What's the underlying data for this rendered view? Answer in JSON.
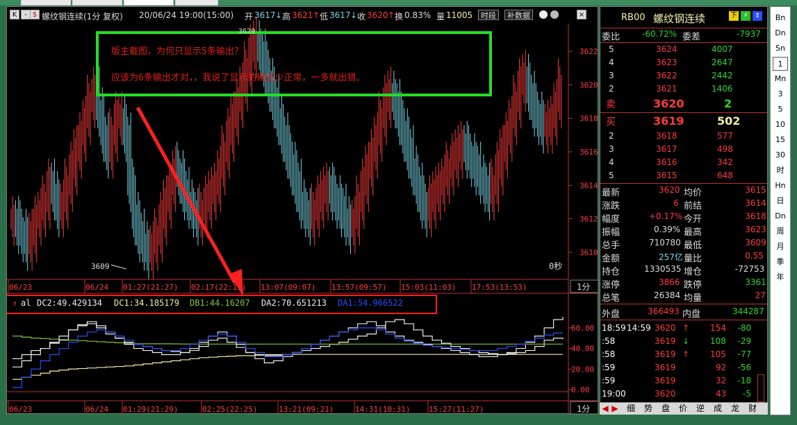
{
  "toolbar": {
    "k_btn": "K",
    "symbol": "螺纹钢连续(1分 复权)",
    "datetime": "20/06/24 19:00(15:00)",
    "open_label": "开",
    "open_value": "3617",
    "high_label": "高",
    "high_value": "3621",
    "low_label": "低",
    "low_value": "3617",
    "close_label": "收",
    "close_value": "3620",
    "turnover_label": "换",
    "turnover_value": "0.83%",
    "volume_label": "量",
    "volume_value": "11005",
    "btn_period": "时段",
    "btn_supplement": "补数据"
  },
  "annotation": {
    "line1": "版主截图，为何只显示5条输出？",
    "line2": "应该为6条输出才对，，我说了显示的输出少正常，一多就出错。",
    "peak_label": "3620"
  },
  "main_panel": {
    "low_marker": "3609",
    "countdown": "0秒",
    "period": "1分",
    "y_ticks": [
      "3622",
      "3620",
      "3618",
      "3616",
      "3614",
      "3612",
      "3610"
    ],
    "x_ticks": [
      "06/23",
      "06/24",
      "01:27(21:27)",
      "02:17(22:17)",
      "13:07(09:07)",
      "13:57(09:57)",
      "15:03(11:03)",
      "17:53(13:53)"
    ]
  },
  "indicator": {
    "name": "al",
    "dc2": "DC2:49.429134",
    "dc1": "DC1:34.185179",
    "db1": "DB1:44.16207",
    "da2": "DA2:70.651213",
    "da1": "DA1:54.966522",
    "y_ticks": [
      "60.00",
      "40.00",
      "20.00",
      "0.00"
    ],
    "x_ticks": [
      "06/23",
      "06/24",
      "01:29(21:29)",
      "02:25(22:25)",
      "13:21(09:21)",
      "14:31(10:31)",
      "15:27(11:27)"
    ],
    "period": "1分"
  },
  "colors": {
    "up": "#ff3b3b",
    "down": "#78d7e8",
    "white_series": "#f0f0f0",
    "blue_series": "#2a4dff",
    "green_series": "#7ec83a",
    "yellow_series": "#f3f0a6",
    "annotation_box": "#22e022",
    "arrow": "#ff2020"
  },
  "quote": {
    "code": "RB00",
    "name": "螺纹钢连续",
    "weibi_label": "委比",
    "weibi_value": "-60.72%",
    "weicha_label": "委差",
    "weicha_value": "-7937",
    "asks": [
      {
        "level": "5",
        "price": "3624",
        "vol": "4007"
      },
      {
        "level": "4",
        "price": "3623",
        "vol": "2647"
      },
      {
        "level": "3",
        "price": "3622",
        "vol": "2442"
      },
      {
        "level": "2",
        "price": "3621",
        "vol": "1406"
      }
    ],
    "sell1": {
      "label": "卖",
      "price": "3620",
      "vol": "2"
    },
    "buy1": {
      "label": "买",
      "price": "3619",
      "vol": "502"
    },
    "bids": [
      {
        "level": "2",
        "price": "3618",
        "vol": "577"
      },
      {
        "level": "3",
        "price": "3617",
        "vol": "498"
      },
      {
        "level": "4",
        "price": "3616",
        "vol": "342"
      },
      {
        "level": "5",
        "price": "3615",
        "vol": "648"
      }
    ],
    "stats": [
      {
        "l1": "最新",
        "v1": "3620",
        "l2": "均价",
        "v2": "3615"
      },
      {
        "l1": "涨跌",
        "v1": "6",
        "l2": "前结",
        "v2": "3614"
      },
      {
        "l1": "幅度",
        "v1": "+0.17%",
        "l2": "今开",
        "v2": "3618"
      },
      {
        "l1": "振幅",
        "v1": "0.39%",
        "l2": "最高",
        "v2": "3623"
      },
      {
        "l1": "总手",
        "v1": "710780",
        "l2": "最低",
        "v2": "3609"
      },
      {
        "l1": "金额",
        "v1": "257亿",
        "l2": "量比",
        "v2": "0.55"
      },
      {
        "l1": "持仓",
        "v1": "1330535",
        "l2": "增仓",
        "v2": "-72753"
      },
      {
        "l1": "涨停",
        "v1": "3866",
        "l2": "跌停",
        "v2": "3361"
      },
      {
        "l1": "总笔",
        "v1": "26384",
        "l2": "均量",
        "v2": "27"
      }
    ],
    "outer_label": "外盘",
    "outer_value": "366493",
    "inner_label": "内盘",
    "inner_value": "344287",
    "ticks": [
      {
        "time": "18:59",
        "time2": "14:59",
        "price": "3620",
        "dir": "↑",
        "vol": "154",
        "chg": "-80"
      },
      {
        "time": ":58",
        "time2": "",
        "price": "3619",
        "dir": "↓",
        "vol": "108",
        "chg": "-29"
      },
      {
        "time": ":58",
        "time2": "",
        "price": "3619",
        "dir": "↑",
        "vol": "105",
        "chg": "-77"
      },
      {
        "time": ":59",
        "time2": "",
        "price": "3619",
        "dir": "",
        "vol": "92",
        "chg": "-56"
      },
      {
        "time": ":59",
        "time2": "",
        "price": "3619",
        "dir": "",
        "vol": "32",
        "chg": "-18"
      },
      {
        "time": "19:00",
        "time2": "",
        "price": "3620",
        "dir": "",
        "vol": "43",
        "chg": "-5"
      }
    ],
    "bottom_tabs": [
      "细",
      "势",
      "盘",
      "价",
      "逆",
      "成",
      "龙",
      "财"
    ]
  },
  "sidebar": {
    "items": [
      "Bn",
      "Dn",
      "Sn",
      "1",
      "Mn",
      "3",
      "5",
      "10",
      "15",
      "30",
      "时",
      "Hn",
      "日",
      "Dn",
      "周",
      "月",
      "季",
      "年"
    ]
  },
  "chart_data": [
    {
      "type": "bar",
      "title": "螺纹钢连续(1分 复权)",
      "ylim": [
        3609,
        3623
      ],
      "ticks_y": [
        3610,
        3612,
        3614,
        3616,
        3618,
        3620,
        3622
      ],
      "ticks_x": [
        "06/23",
        "06/24",
        "01:27(21:27)",
        "02:17(22:17)",
        "13:07(09:07)",
        "13:57(09:57)",
        "15:03(11:03)",
        "17:53(13:53)"
      ],
      "grid": false,
      "series": [
        {
          "name": "close",
          "values": [
            3612,
            3611.5,
            3611,
            3610.5,
            3611,
            3612,
            3612.5,
            3613,
            3614,
            3613.5,
            3612.5,
            3613,
            3614,
            3615,
            3616,
            3617,
            3618,
            3619,
            3619.5,
            3618.5,
            3617,
            3616,
            3617,
            3618,
            3618,
            3617,
            3614,
            3612,
            3611,
            3610.5,
            3610,
            3610.5,
            3611,
            3612,
            3613,
            3614,
            3615,
            3614.5,
            3613.5,
            3613,
            3612.5,
            3612,
            3612.5,
            3613,
            3613.5,
            3614,
            3615,
            3616,
            3617,
            3618,
            3619,
            3620,
            3621,
            3622,
            3622.5,
            3622,
            3621,
            3620,
            3619,
            3618,
            3617,
            3616,
            3615,
            3614,
            3613,
            3612.5,
            3612,
            3612.5,
            3613,
            3613.5,
            3614,
            3613.5,
            3613,
            3612.5,
            3612,
            3611.5,
            3612,
            3613,
            3614,
            3615,
            3616,
            3617,
            3618,
            3619,
            3619.5,
            3619,
            3618,
            3617,
            3616,
            3615,
            3614,
            3613,
            3612.5,
            3613,
            3613.5,
            3614,
            3614.5,
            3615,
            3615.5,
            3616,
            3616.5,
            3616,
            3615.5,
            3615,
            3614.5,
            3614,
            3613.5,
            3614,
            3615,
            3616,
            3617,
            3618,
            3619,
            3620,
            3620.5,
            3619.5,
            3618.5,
            3618,
            3617.5,
            3617.5,
            3618,
            3619,
            3620
          ]
        }
      ]
    },
    {
      "type": "line",
      "title": "al",
      "ylim": [
        0,
        70
      ],
      "ticks_y": [
        0,
        20,
        40,
        60
      ],
      "ticks_x": [
        "06/23",
        "06/24",
        "01:29(21:29)",
        "02:25(22:25)",
        "13:21(09:21)",
        "14:31(10:31)",
        "15:27(11:27)"
      ],
      "series": [
        {
          "name": "DC2",
          "values": [
            30,
            34,
            38,
            40,
            45,
            48,
            58,
            62,
            64,
            60,
            54,
            50,
            46,
            44,
            42,
            40,
            38,
            37,
            36,
            38,
            42,
            48,
            50,
            46,
            41,
            36,
            34,
            33,
            33,
            34,
            36,
            38,
            40,
            42,
            44,
            46,
            49,
            52,
            54,
            60,
            66,
            68,
            64,
            58,
            52,
            48,
            45,
            42,
            40,
            38,
            36,
            35,
            34,
            35,
            36,
            38,
            42,
            48,
            50,
            49
          ]
        },
        {
          "name": "DC1",
          "values": [
            10,
            12,
            14,
            16,
            18,
            19,
            20,
            20.5,
            21,
            21.5,
            22,
            22.5,
            23,
            24,
            25,
            26,
            27,
            28,
            29,
            30,
            31,
            31.5,
            32,
            32.5,
            33,
            33,
            33.5,
            34,
            34,
            34,
            34.2,
            34.2,
            34.2,
            34.2,
            34.2,
            34.2,
            34.2,
            34.2,
            34.2,
            34.2,
            34.2,
            34.2,
            34.2,
            34.2,
            34.2,
            34.2,
            34.2,
            34.2,
            34.2,
            34.2,
            34.2,
            34.2,
            34.2,
            34.2,
            34.2,
            34.2,
            34.2,
            34.2,
            34.2,
            34.2
          ]
        },
        {
          "name": "DB1",
          "values": [
            52,
            51,
            50,
            49.5,
            49,
            48.5,
            48,
            47.5,
            47,
            46.5,
            46,
            45.5,
            45,
            44.5,
            44.5,
            44.5,
            44.5,
            44.4,
            44.3,
            44.3,
            44.2,
            44.2,
            44.2,
            44.2,
            44.2,
            44.2,
            44.2,
            44.2,
            44.2,
            44.2,
            44.2,
            44.2,
            44.2,
            44.2,
            44.2,
            44.2,
            44.2,
            44.2,
            44.2,
            44.2,
            44.2,
            44.2,
            44.2,
            44.2,
            44.2,
            44.2,
            44.2,
            44.2,
            44.2,
            44.2,
            44.2,
            44.2,
            44.2,
            44.2,
            44.2,
            44.2,
            44.2,
            44.2,
            44.2,
            44.2
          ]
        },
        {
          "name": "DA2",
          "values": [
            22,
            28,
            34,
            40,
            46,
            52,
            58,
            63,
            66,
            62,
            56,
            50,
            44,
            40,
            38,
            36,
            34,
            34,
            36,
            40,
            46,
            52,
            56,
            52,
            44,
            36,
            30,
            26,
            28,
            32,
            36,
            40,
            44,
            48,
            52,
            56,
            60,
            64,
            66,
            62,
            56,
            52,
            48,
            46,
            44,
            42,
            40,
            38,
            36,
            34,
            32,
            32,
            34,
            36,
            40,
            46,
            52,
            60,
            68,
            70.6
          ]
        },
        {
          "name": "DA1",
          "values": [
            2,
            12,
            20,
            28,
            34,
            40,
            46,
            52,
            56,
            58,
            56,
            52,
            48,
            44,
            42,
            40,
            38,
            38,
            40,
            44,
            48,
            52,
            54,
            52,
            46,
            40,
            36,
            32,
            32,
            34,
            36,
            40,
            44,
            48,
            52,
            56,
            58,
            60,
            60,
            58,
            54,
            50,
            47,
            45,
            43,
            42,
            41,
            40,
            39,
            38,
            38,
            38,
            40,
            42,
            44,
            47,
            50,
            53,
            55,
            55
          ]
        }
      ]
    }
  ]
}
